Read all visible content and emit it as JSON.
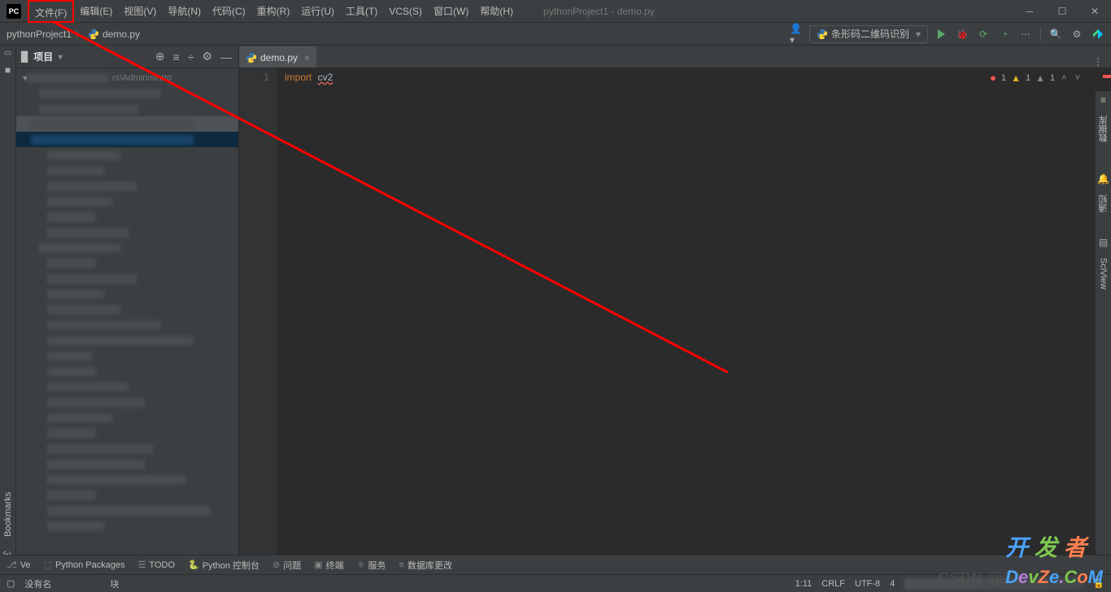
{
  "menubar": {
    "items": [
      "文件(F)",
      "编辑(E)",
      "视图(V)",
      "导航(N)",
      "代码(C)",
      "重构(R)",
      "运行(U)",
      "工具(T)",
      "VCS(S)",
      "窗口(W)",
      "帮助(H)"
    ],
    "title": "pythonProject1 - demo.py"
  },
  "nav": {
    "crumbs": [
      "pythonProject1",
      "demo.py"
    ],
    "run_config": "条形码二维码识别"
  },
  "project_panel": {
    "header": "项目",
    "visible_path": "rs\\Administrato"
  },
  "editor": {
    "tab": "demo.py",
    "line_number": "1",
    "code_keyword": "import",
    "code_module": "cv2",
    "inspect": {
      "errors": "1",
      "warnings": "1",
      "weak": "1"
    }
  },
  "left_tools": {
    "structure": "结构",
    "bookmarks": "Bookmarks"
  },
  "right_tools": {
    "database": "数据库",
    "notifications": "通知",
    "sciview": "SciView"
  },
  "bottom_tools": {
    "version": "Ve",
    "python_packages": "Python Packages",
    "todo": "TODO",
    "python_console": "Python 控制台",
    "problems": "问题",
    "terminal": "终端",
    "services": "服务",
    "db_changes": "数据库更改"
  },
  "status_bar": {
    "no_name": "没有名",
    "block": "块",
    "pos": "1:11",
    "le": "CRLF",
    "enc": "UTF-8",
    "indent": "4"
  },
  "watermark": {
    "csdn": "CSDN @24",
    "dev": "DevZe.CoM"
  }
}
